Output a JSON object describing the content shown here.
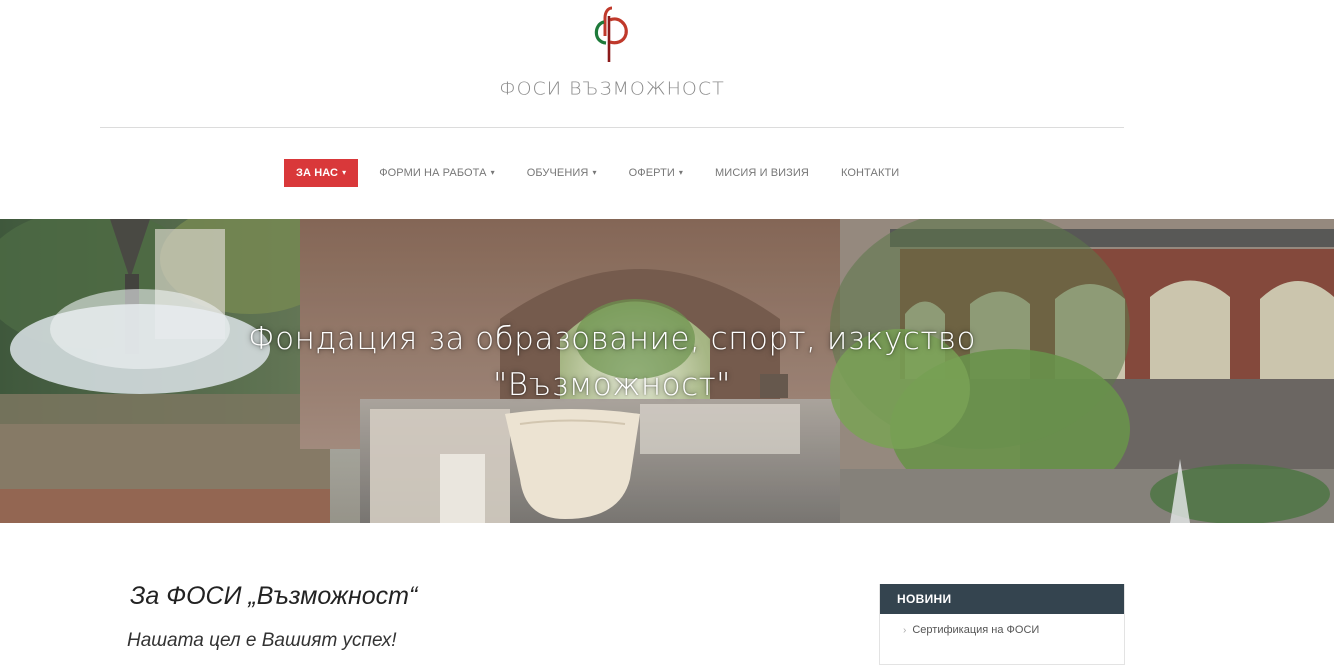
{
  "site": {
    "name": "ФОСИ ВЪЗМОЖНОСТ"
  },
  "nav": {
    "items": [
      {
        "label": "ЗА НАС",
        "has_dropdown": true,
        "active": true
      },
      {
        "label": "ФОРМИ НА РАБОТА",
        "has_dropdown": true,
        "active": false
      },
      {
        "label": "ОБУЧЕНИЯ",
        "has_dropdown": true,
        "active": false
      },
      {
        "label": "ОФЕРТИ",
        "has_dropdown": true,
        "active": false
      },
      {
        "label": "МИСИЯ И ВИЗИЯ",
        "has_dropdown": false,
        "active": false
      },
      {
        "label": "КОНТАКТИ",
        "has_dropdown": false,
        "active": false
      }
    ],
    "caret": "⌄",
    "active_color": "#d9383a"
  },
  "hero": {
    "line1": "Фондация за образование, спорт, изкуство",
    "line2": "\"Възможност\""
  },
  "main": {
    "title": "За ФОСИ „Възможност“",
    "subtitle": "Нашата цел е Вашият успех!"
  },
  "sidebar": {
    "widget_title": "НОВИНИ",
    "widget_color": "#34444f",
    "items": [
      "Сертификация на ФОСИ"
    ]
  },
  "icons": {
    "logo": "phi-logo-icon",
    "item_arrow": "›"
  }
}
